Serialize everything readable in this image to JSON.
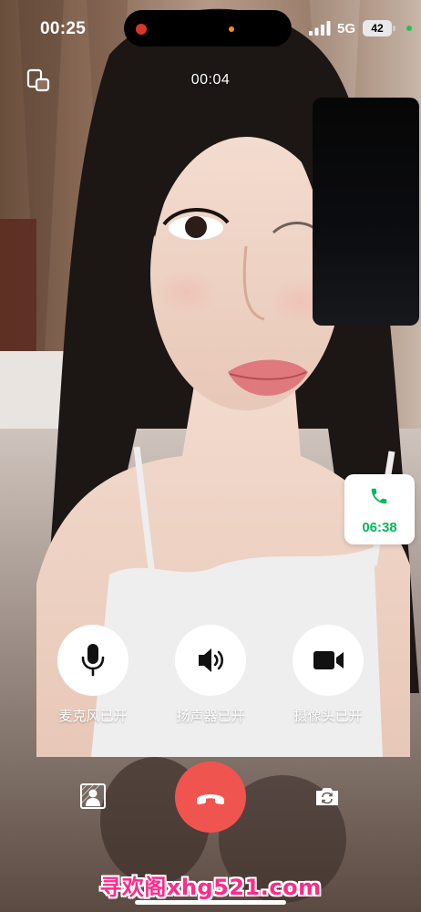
{
  "status_bar": {
    "time": "00:25",
    "network": "5G",
    "battery": "42"
  },
  "call": {
    "timer": "00:04"
  },
  "floating_card": {
    "time": "06:38"
  },
  "controls": [
    {
      "label": "麦克风已开",
      "icon": "microphone-icon"
    },
    {
      "label": "扬声器已开",
      "icon": "speaker-icon"
    },
    {
      "label": "摄像头已开",
      "icon": "video-camera-icon"
    }
  ],
  "bottom_controls": {
    "left_icon": "background-blur-icon",
    "center_icon": "hang-up-icon",
    "right_icon": "flip-camera-icon"
  },
  "watermark": "寻欢阁xhg521.com",
  "colors": {
    "hangup_red": "#f0544f",
    "accent_green": "#07b85a",
    "watermark_pink": "#ff2a8a"
  }
}
